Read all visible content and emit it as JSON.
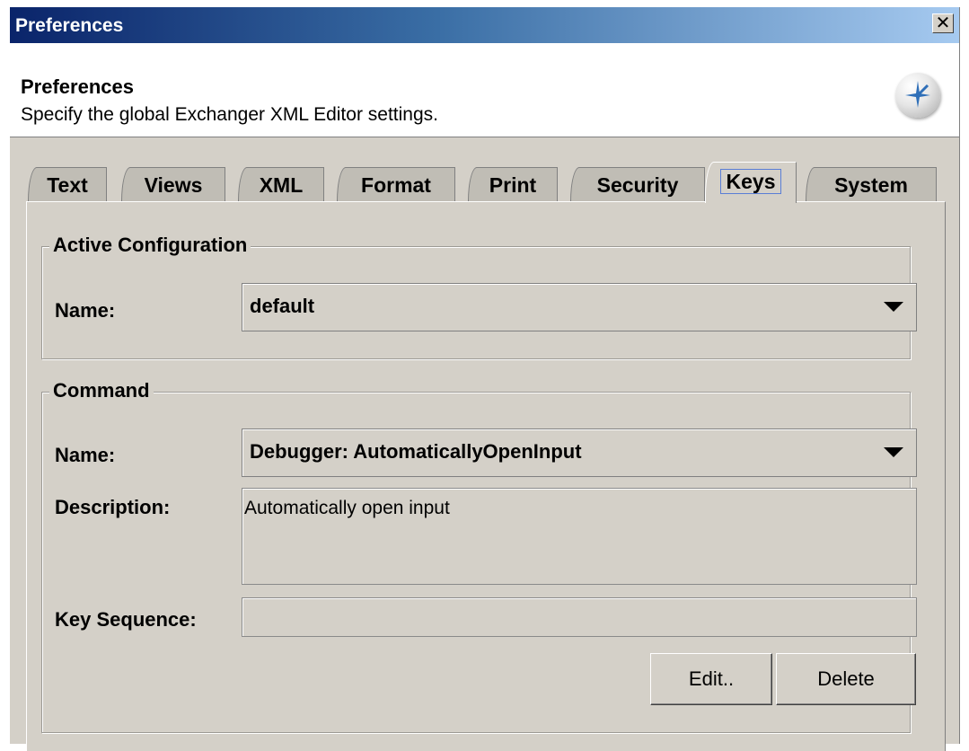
{
  "window": {
    "title": "Preferences",
    "close_label": "✕"
  },
  "header": {
    "title": "Preferences",
    "subtitle": "Specify the global Exchanger XML Editor settings."
  },
  "tabs": [
    {
      "label": "Text"
    },
    {
      "label": "Views"
    },
    {
      "label": "XML"
    },
    {
      "label": "Format"
    },
    {
      "label": "Print"
    },
    {
      "label": "Security"
    },
    {
      "label": "Keys",
      "active": true
    },
    {
      "label": "System"
    }
  ],
  "active_configuration": {
    "legend": "Active Configuration",
    "name_label": "Name:",
    "name_value": "default"
  },
  "command": {
    "legend": "Command",
    "name_label": "Name:",
    "name_value": "Debugger:  AutomaticallyOpenInput",
    "description_label": "Description:",
    "description_value": "Automatically open input",
    "key_sequence_label": "Key Sequence:",
    "key_sequence_value": "",
    "edit_label": "Edit..",
    "delete_label": "Delete"
  },
  "colors": {
    "title_gradient_start": "#0a246a",
    "title_gradient_end": "#a6caf0",
    "window_background": "#d4d0c8",
    "active_tab_focus": "#5a7ed6"
  },
  "icons": {
    "logo": "exchanger-sparkle-icon",
    "close": "close-icon",
    "dropdown": "chevron-down-icon"
  }
}
